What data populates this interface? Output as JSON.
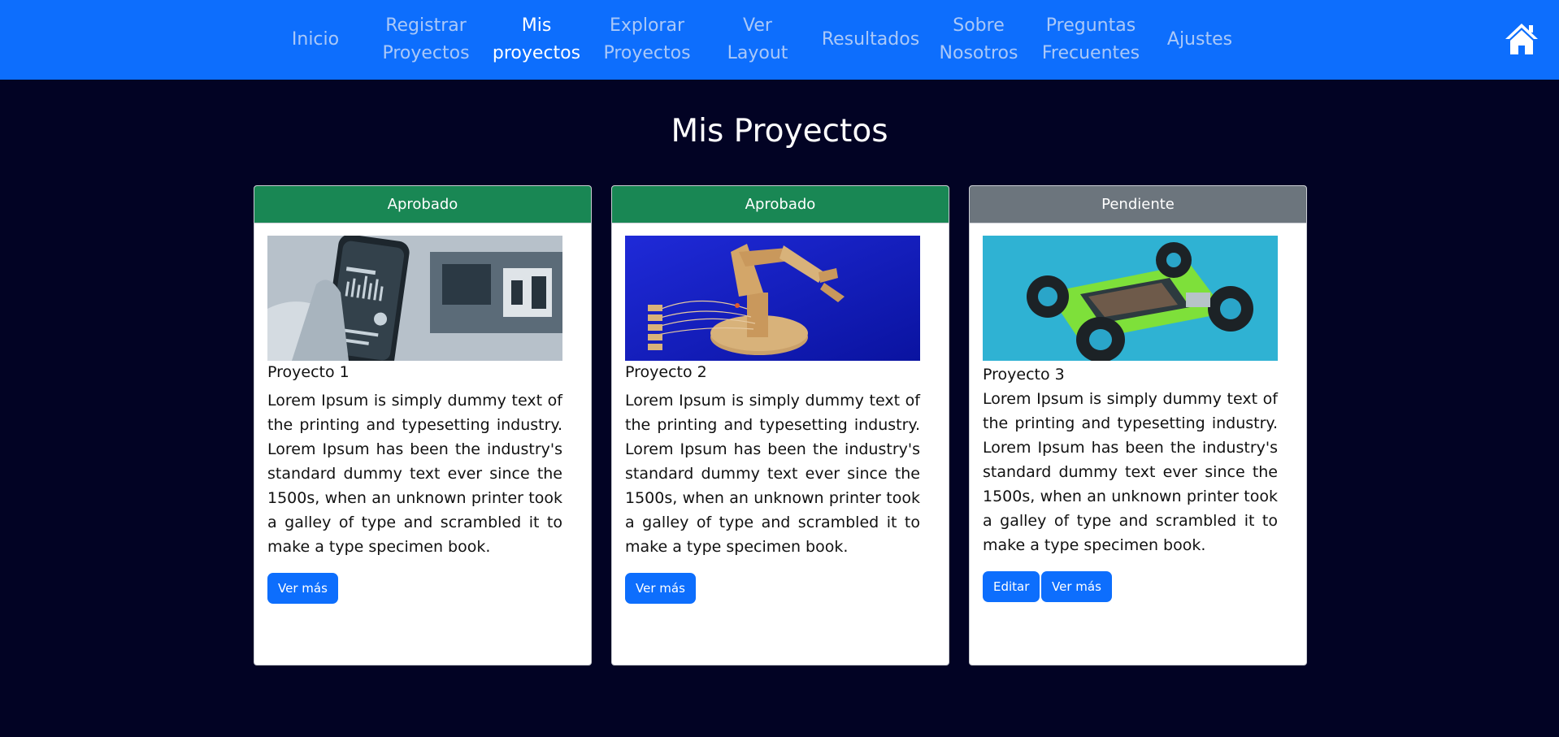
{
  "nav": {
    "items": [
      {
        "label": "Inicio"
      },
      {
        "label": "Registrar\nProyectos"
      },
      {
        "label": "Mis\nproyectos"
      },
      {
        "label": "Explorar\nProyectos"
      },
      {
        "label": "Ver\nLayout"
      },
      {
        "label": "Resultados"
      },
      {
        "label": "Sobre\nNosotros"
      },
      {
        "label": "Preguntas\nFrecuentes"
      },
      {
        "label": "Ajustes"
      }
    ],
    "home_icon": "home-icon"
  },
  "page": {
    "title": "Mis Proyectos"
  },
  "colors": {
    "navbar": "#0d6efd",
    "background": "#020324",
    "approved": "#198754",
    "pending": "#6c757d",
    "button": "#0d6efd"
  },
  "cards": [
    {
      "status": "Aprobado",
      "title": "Proyecto 1",
      "text": "Lorem Ipsum is simply dummy text of the printing and typesetting industry. Lorem Ipsum has been the industry's standard dummy text ever since the 1500s, when an unknown printer took a galley of type and scrambled it to make a type specimen book.",
      "buttons": [
        "Ver más"
      ]
    },
    {
      "status": "Aprobado",
      "title": "Proyecto 2",
      "text": "Lorem Ipsum is simply dummy text of the printing and typesetting industry. Lorem Ipsum has been the industry's standard dummy text ever since the 1500s, when an unknown printer took a galley of type and scrambled it to make a type specimen book.",
      "buttons": [
        "Ver más"
      ]
    },
    {
      "status": "Pendiente",
      "title": "Proyecto 3",
      "text": "Lorem Ipsum is simply dummy text of the printing and typesetting industry. Lorem Ipsum has been the industry's standard dummy text ever since the 1500s, when an unknown printer took a galley of type and scrambled it to make a type specimen book.",
      "buttons": [
        "Editar",
        "Ver más"
      ]
    }
  ]
}
